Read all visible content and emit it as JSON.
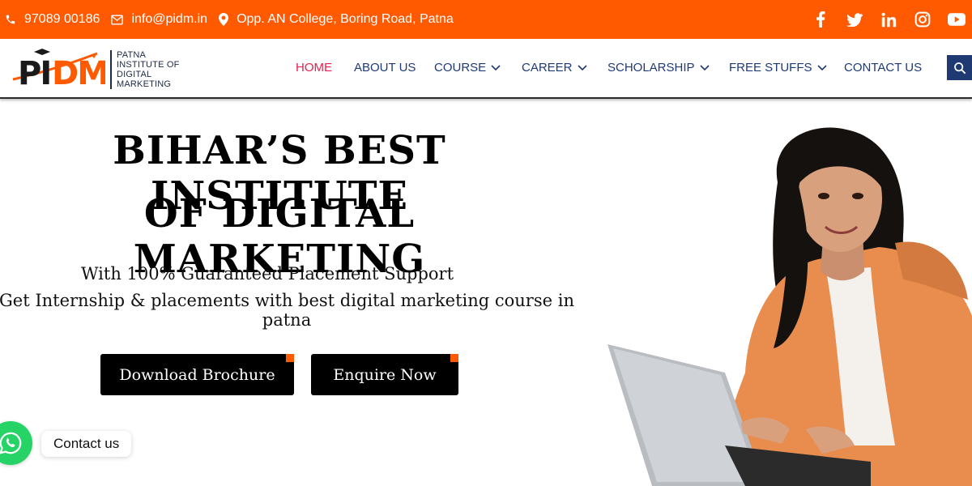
{
  "topbar": {
    "phone": "97089 00186",
    "email": "info@pidm.in",
    "address": "Opp. AN College, Boring Road, Patna",
    "bg_color": "#ff5a00",
    "social_icons": [
      "facebook-icon",
      "twitter-icon",
      "linkedin-icon",
      "instagram-icon",
      "youtube-icon"
    ]
  },
  "logo": {
    "mark_text": "PIDM",
    "line1": "PATNA",
    "line2": "INSTITUTE OF",
    "line3": "DIGITAL MARKETING"
  },
  "nav": {
    "items": [
      {
        "label": "HOME",
        "active": true,
        "dropdown": false
      },
      {
        "label": "ABOUT US",
        "active": false,
        "dropdown": false
      },
      {
        "label": "COURSE",
        "active": false,
        "dropdown": true
      },
      {
        "label": "CAREER",
        "active": false,
        "dropdown": true
      },
      {
        "label": "SCHOLARSHIP",
        "active": false,
        "dropdown": true
      },
      {
        "label": "FREE STUFFS",
        "active": false,
        "dropdown": true
      },
      {
        "label": "CONTACT US",
        "active": false,
        "dropdown": false
      }
    ],
    "active_color": "#e8204f",
    "text_color": "#1f3a73"
  },
  "hero": {
    "title_line1": "BIHAR’S BEST INSTITUTE",
    "title_line2": "OF DIGITAL MARKETING",
    "subtitle1": "With 100% Guaranteed Placement Support",
    "subtitle2": "Get Internship & placements with best digital marketing course in patna",
    "btn_download": "Download Brochure",
    "btn_enquire": "Enquire Now"
  },
  "whatsapp": {
    "label": "Contact us",
    "color": "#25d366"
  }
}
